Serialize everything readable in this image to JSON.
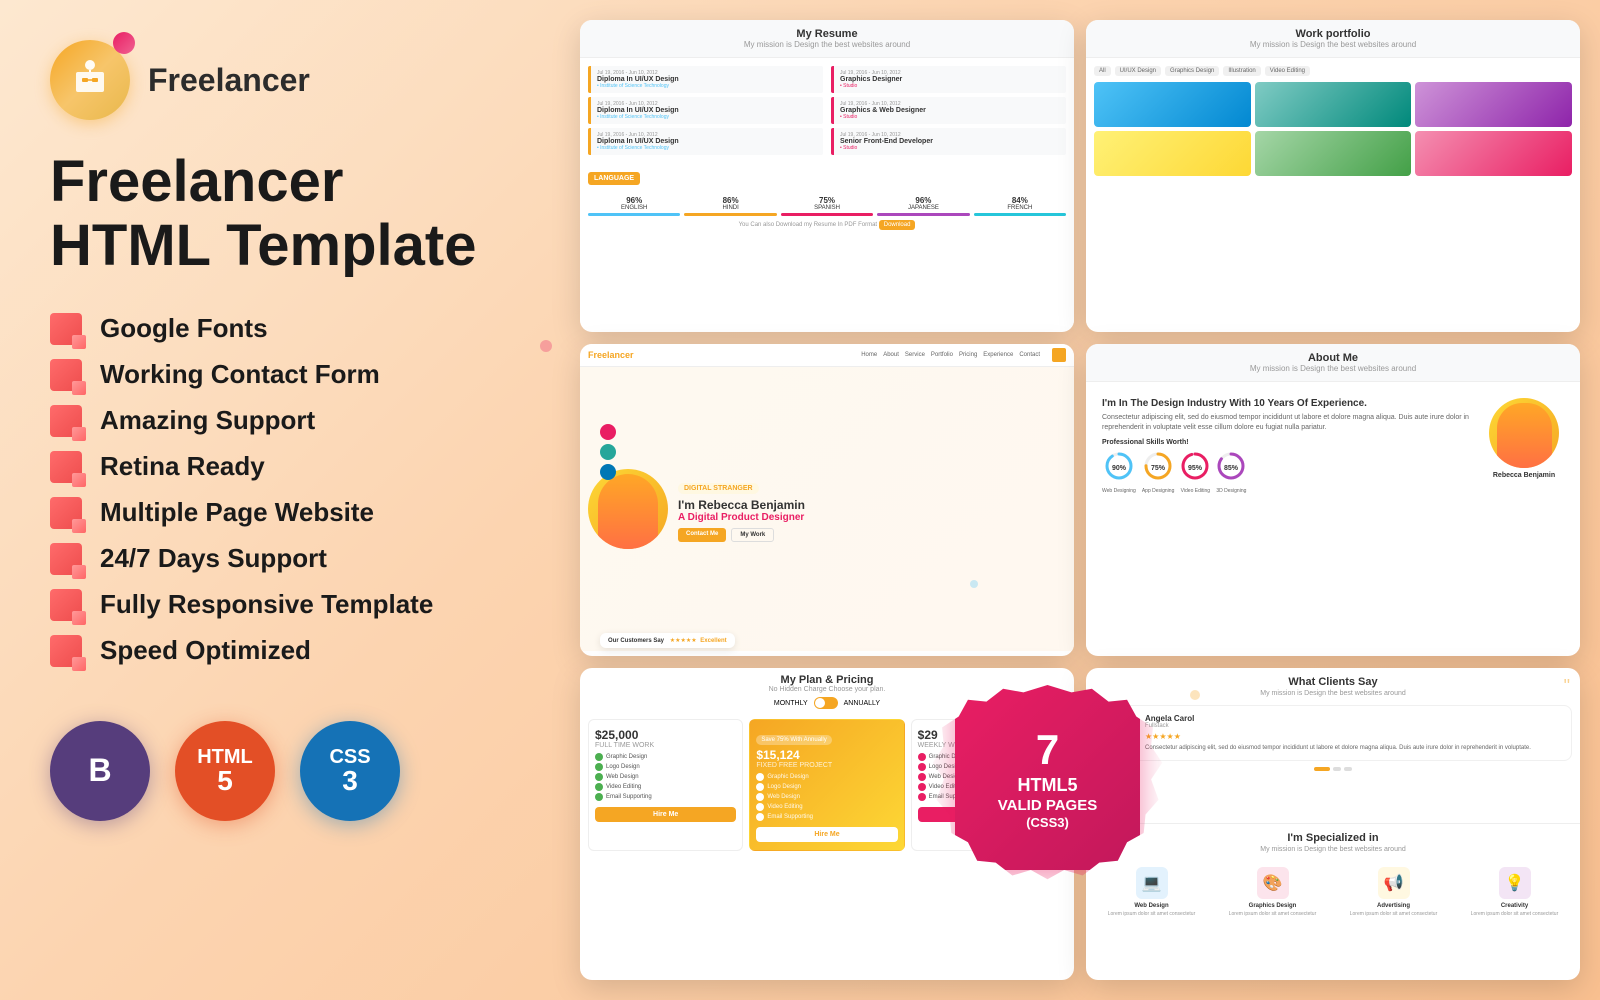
{
  "logo": {
    "text": "Freelancer"
  },
  "title": {
    "line1": "Freelancer",
    "line2": "HTML Template"
  },
  "features": [
    {
      "id": "google-fonts",
      "label": "Google Fonts"
    },
    {
      "id": "working-contact-form",
      "label": "Working Contact Form"
    },
    {
      "id": "amazing-support",
      "label": "Amazing Support"
    },
    {
      "id": "retina-ready",
      "label": "Retina Ready"
    },
    {
      "id": "multiple-page",
      "label": "Multiple Page Website"
    },
    {
      "id": "247-support",
      "label": "24/7 Days Support"
    },
    {
      "id": "fully-responsive",
      "label": "Fully Responsive Template"
    },
    {
      "id": "speed-optimized",
      "label": "Speed Optimized"
    }
  ],
  "badges": [
    {
      "id": "bootstrap",
      "symbol": "B",
      "label": ""
    },
    {
      "id": "html5",
      "symbol": "5",
      "label": "HTML"
    },
    {
      "id": "css3",
      "symbol": "3",
      "label": "CSS"
    }
  ],
  "sticker": {
    "number": "7",
    "line1": "HTML5",
    "line2": "VALID PAGES",
    "line3": "(CSS3)"
  },
  "screenshots": {
    "resume": {
      "title": "My Resume",
      "subtitle": "My mission is Design the best websites around"
    },
    "portfolio": {
      "title": "Work portfolio",
      "subtitle": "My mission is Design the best websites around",
      "tabs": [
        "All",
        "UI/UX Design",
        "Graphics Design",
        "Illustration",
        "Video Editing"
      ]
    },
    "hero": {
      "brand": "Freelancer",
      "nav_links": [
        "Home",
        "About",
        "Service",
        "Portfolio",
        "Pricing",
        "Experience",
        "Contact"
      ],
      "label": "DIGITAL STRANGER",
      "name": "I'm Rebecca Benjamin",
      "role_prefix": "A Digital Product",
      "role_suffix": " Designer",
      "btn1": "Contact Me",
      "btn2": "My Work",
      "testimonial": "Our Customers Say",
      "rating": "Excellent"
    },
    "about": {
      "title": "About Me",
      "subtitle": "My mission is Design the best websites around",
      "heading": "I'm In The Design Industry With 10 Years Of Experience.",
      "body": "Consectetur adipiscing elit, sed do eiusmod tempor incididunt ut labore et dolore magna aliqua. Duis aute irure dolor in reprehenderit in voluptate velit esse cillum dolore eu fugiat nulla pariatur.",
      "skills_title": "Professional Skills Worth!",
      "skills": [
        {
          "name": "Web Designing",
          "pct": "90%"
        },
        {
          "name": "App Designing",
          "pct": "75%"
        },
        {
          "name": "Video Editing",
          "pct": "95%"
        },
        {
          "name": "3D Designing",
          "pct": "85%"
        }
      ],
      "person_name": "Rebecca Benjamin"
    },
    "pricing": {
      "title": "My Plan & Pricing",
      "subtitle": "No Hidden Charge Choose your plan.",
      "toggle_label1": "MONTHLY",
      "toggle_label2": "ANNUALLY",
      "plans": [
        {
          "amount": "$25,000",
          "type": "FULL TIME WORK",
          "features": [
            "Graphic Design",
            "Logo Design",
            "Web Design",
            "Video Editing",
            "Email Supporting"
          ],
          "btn": "Hire Me",
          "featured": false
        },
        {
          "amount": "$15,124",
          "type": "FIXED FREE PROJECT",
          "features": [
            "Graphic Design",
            "Logo Design",
            "Web Design",
            "Video Editing",
            "Email Supporting"
          ],
          "btn": "Hire Me",
          "featured": true
        },
        {
          "amount": "$29",
          "type": "WEEKLY WORK",
          "features": [
            "Graphic Design",
            "Logo Design",
            "Web Design",
            "Video Editing",
            "Email Supporting"
          ],
          "btn": "Hire Me",
          "featured": false
        }
      ]
    },
    "testimonials": {
      "title": "What Clients Say",
      "subtitle": "My mission is Design the best websites around",
      "reviews": [
        {
          "name": "Angela Carol",
          "role": "Fullstack",
          "stars": "★★★★★",
          "text": "Consectetur adipiscing elit, sed do eiusmod tempor incididunt ut labore et dolore magna aliqua. Duis aute irure dolor in reprehenderit in voluptate."
        }
      ]
    },
    "specialized": {
      "title": "I'm Specialized in",
      "subtitle": "My mission is Design the best websites around",
      "items": [
        {
          "name": "Web Design",
          "icon": "💻"
        },
        {
          "name": "Graphics Design",
          "icon": "🎨"
        },
        {
          "name": "Advertising",
          "icon": "📢"
        },
        {
          "name": "Creativity",
          "icon": "💡"
        }
      ]
    }
  },
  "languages": [
    {
      "name": "ENGLISH",
      "pct": "96%",
      "color": "#4fc3f7"
    },
    {
      "name": "HINDI",
      "pct": "86%",
      "color": "#f5a623"
    },
    {
      "name": "SPANISH",
      "pct": "75%",
      "color": "#e91e63"
    },
    {
      "name": "JAPANESE",
      "pct": "96%",
      "color": "#ab47bc"
    },
    {
      "name": "FRENCH",
      "pct": "84%",
      "color": "#26c6da"
    }
  ]
}
